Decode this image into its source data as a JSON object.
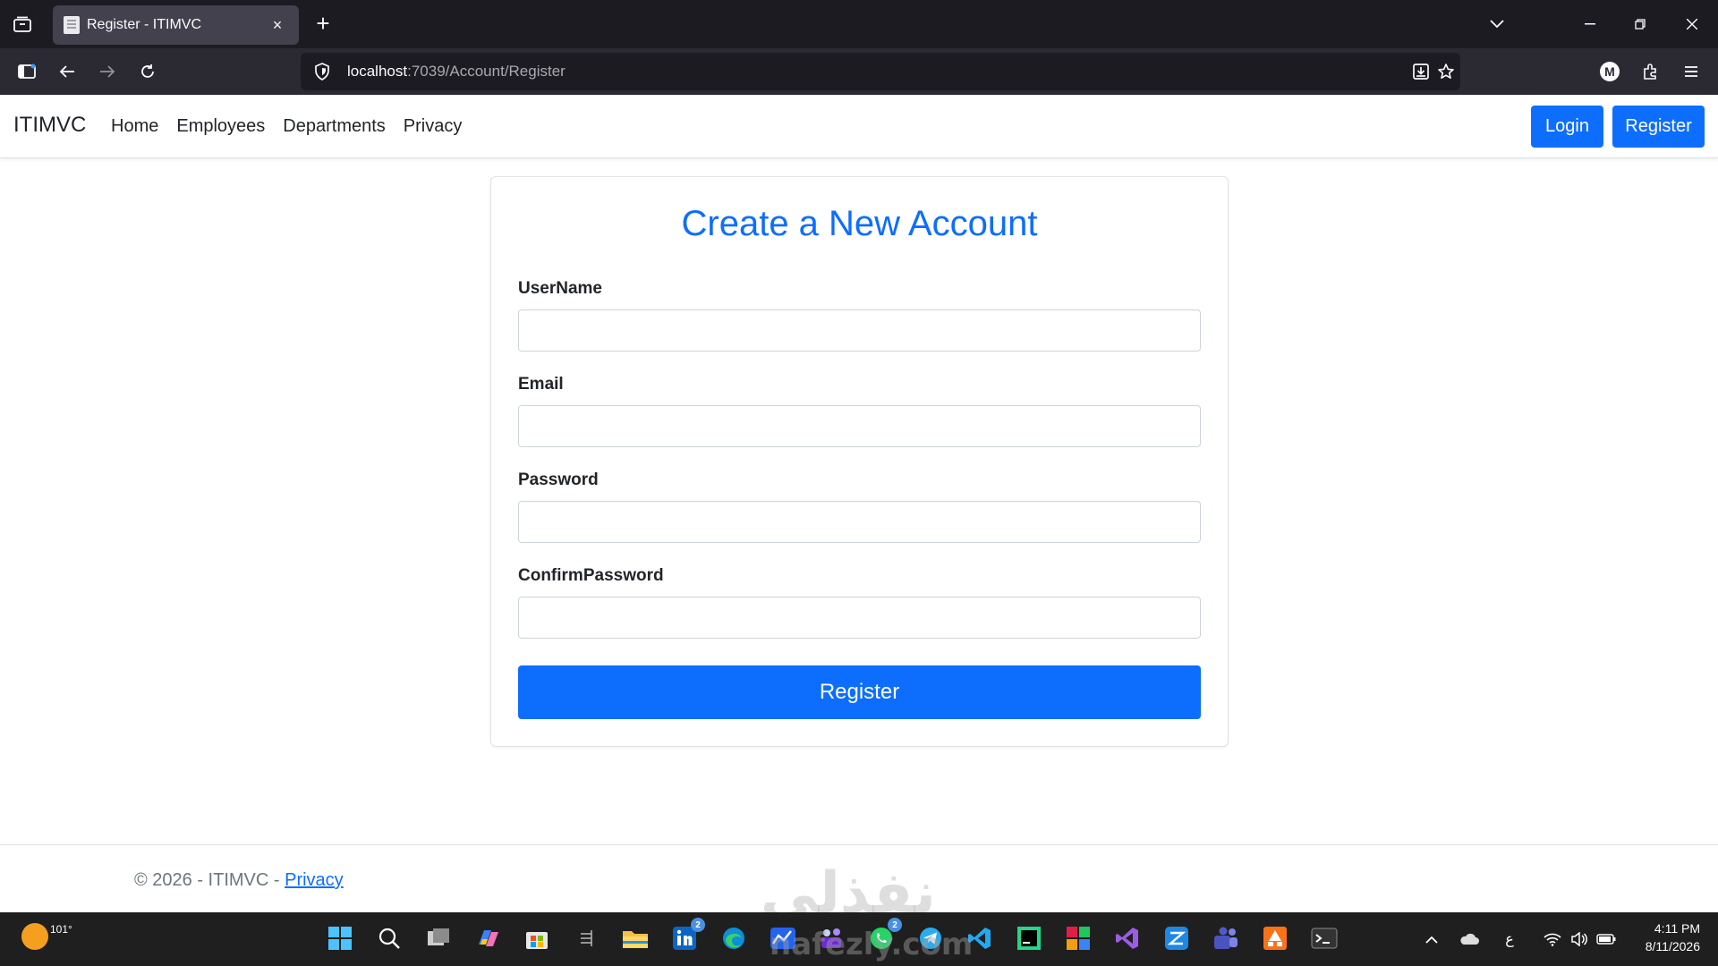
{
  "browser": {
    "tab_title": "Register - ITIMVC",
    "tab_close": "×",
    "new_tab": "+",
    "url_host": "localhost",
    "url_path": ":7039/Account/Register",
    "profile_initial": "M"
  },
  "site": {
    "brand": "ITIMVC",
    "nav": [
      "Home",
      "Employees",
      "Departments",
      "Privacy"
    ],
    "login_label": "Login",
    "register_label": "Register"
  },
  "form": {
    "title": "Create a New Account",
    "fields": [
      {
        "label": "UserName",
        "value": ""
      },
      {
        "label": "Email",
        "value": ""
      },
      {
        "label": "Password",
        "value": ""
      },
      {
        "label": "ConfirmPassword",
        "value": ""
      }
    ],
    "submit_label": "Register"
  },
  "footer": {
    "copyright": "© 2026 - ITIMVC - ",
    "privacy_link": "Privacy"
  },
  "watermark": {
    "arabic": "نفذلي",
    "latin": "nafezly.com"
  },
  "taskbar": {
    "temperature": "101°",
    "linkedin_badge": "2",
    "whatsapp_badge": "2",
    "time": "4:11 PM",
    "date": "8/11/2026",
    "language": "ع"
  }
}
